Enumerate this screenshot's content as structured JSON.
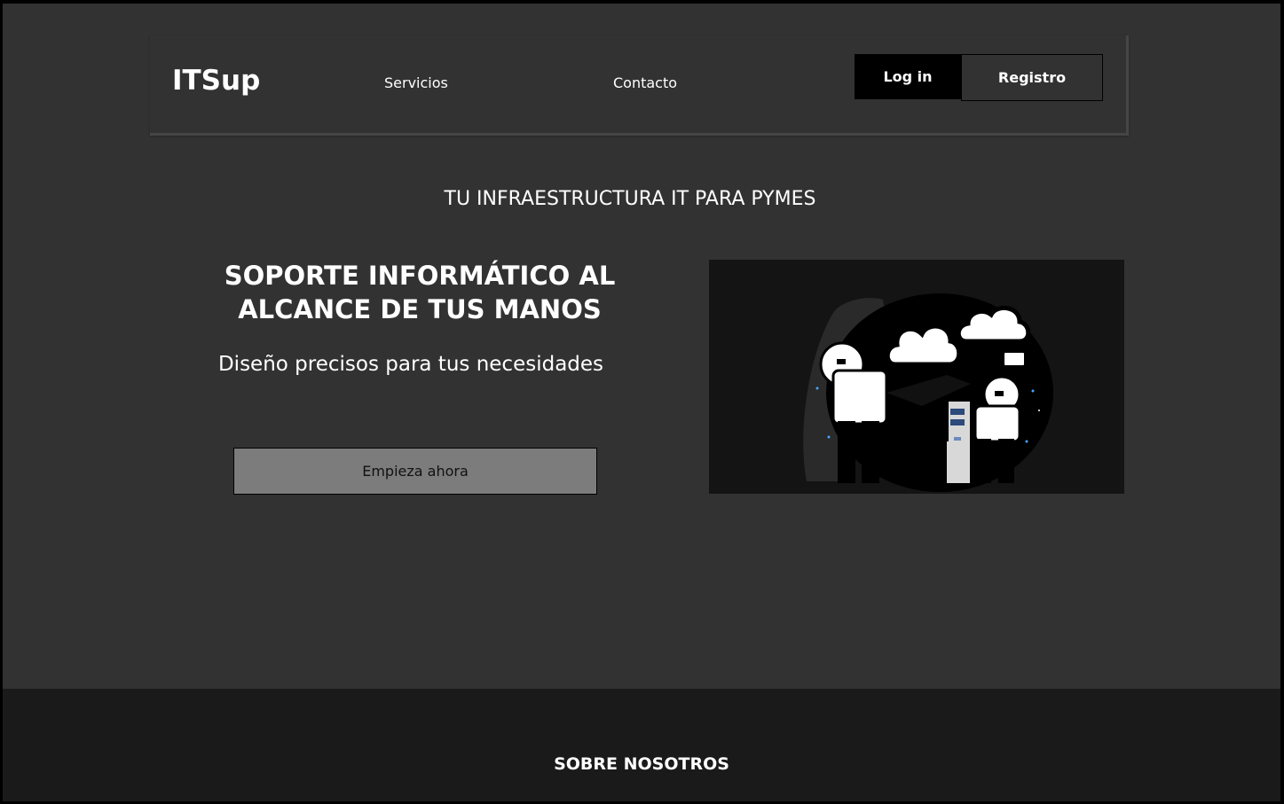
{
  "nav": {
    "logo": "ITSup",
    "links": [
      "Servicios",
      "Contacto"
    ],
    "login_label": "Log in",
    "register_label": "Registro"
  },
  "hero": {
    "tagline": "TU INFRAESTRUCTURA IT PARA PYMES",
    "title": "SOPORTE INFORMÁTICO AL ALCANCE DE TUS MANOS",
    "subtitle": "Diseño precisos para tus necesidades",
    "cta_label": "Empieza ahora",
    "illustration_icon": "people-with-cloud-thoughts-illustration"
  },
  "footer": {
    "title": "SOBRE NOSOTROS"
  },
  "colors": {
    "page_bg": "#323232",
    "footer_bg": "#1a1a1a",
    "login_bg": "#000000",
    "cta_bg": "#7c7c7c",
    "text": "#ffffff"
  }
}
